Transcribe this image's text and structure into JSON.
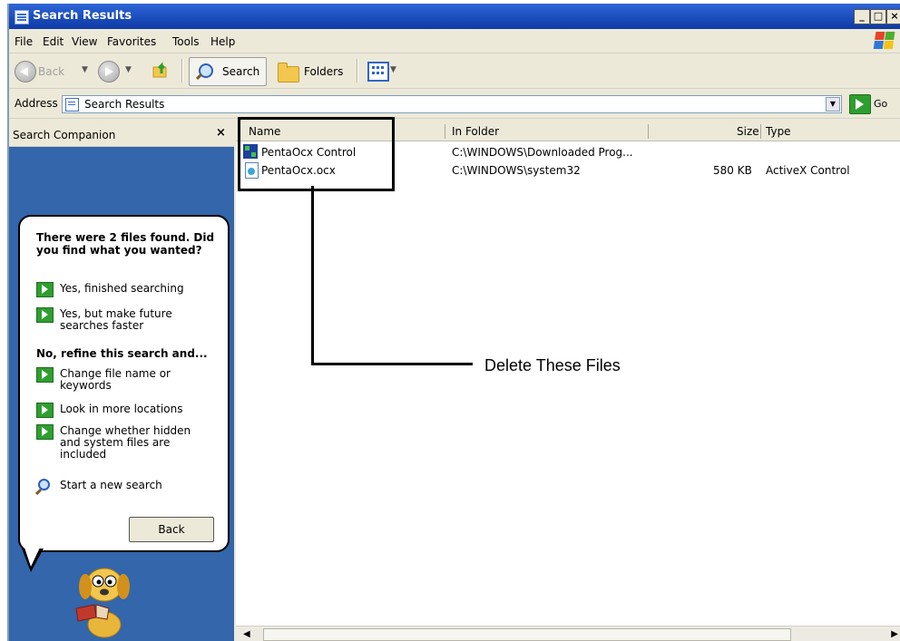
{
  "window": {
    "title": "Search Results"
  },
  "menu": {
    "items": [
      "File",
      "Edit",
      "View",
      "Favorites",
      "Tools",
      "Help"
    ]
  },
  "toolbar": {
    "back_label": "Back",
    "search_label": "Search",
    "folders_label": "Folders"
  },
  "address": {
    "label": "Address",
    "value": "Search Results",
    "go_label": "Go"
  },
  "search_companion": {
    "title": "Search Companion",
    "close_glyph": "×",
    "question": "There were 2 files found. Did you find what you wanted?",
    "refine_heading": "No, refine this search and...",
    "options": [
      "Yes, finished searching",
      "Yes, but make future searches faster",
      "Change file name or keywords",
      "Look in more locations",
      "Change whether hidden and system files are included",
      "Start a new search"
    ],
    "back_button": "Back"
  },
  "results": {
    "columns": [
      "Name",
      "In Folder",
      "Size",
      "Type"
    ],
    "rows": [
      {
        "name": "PentaOcx Control",
        "folder": "C:\\WINDOWS\\Downloaded Prog...",
        "size": "",
        "type": ""
      },
      {
        "name": "PentaOcx.ocx",
        "folder": "C:\\WINDOWS\\system32",
        "size": "580 KB",
        "type": "ActiveX Control"
      }
    ]
  },
  "annotation": {
    "text": "Delete These Files"
  },
  "colors": {
    "title_bar": "#1d4fbf",
    "companion_bg": "#3366aa",
    "go_green": "#2e9e2e",
    "chrome": "#ece9d8"
  }
}
